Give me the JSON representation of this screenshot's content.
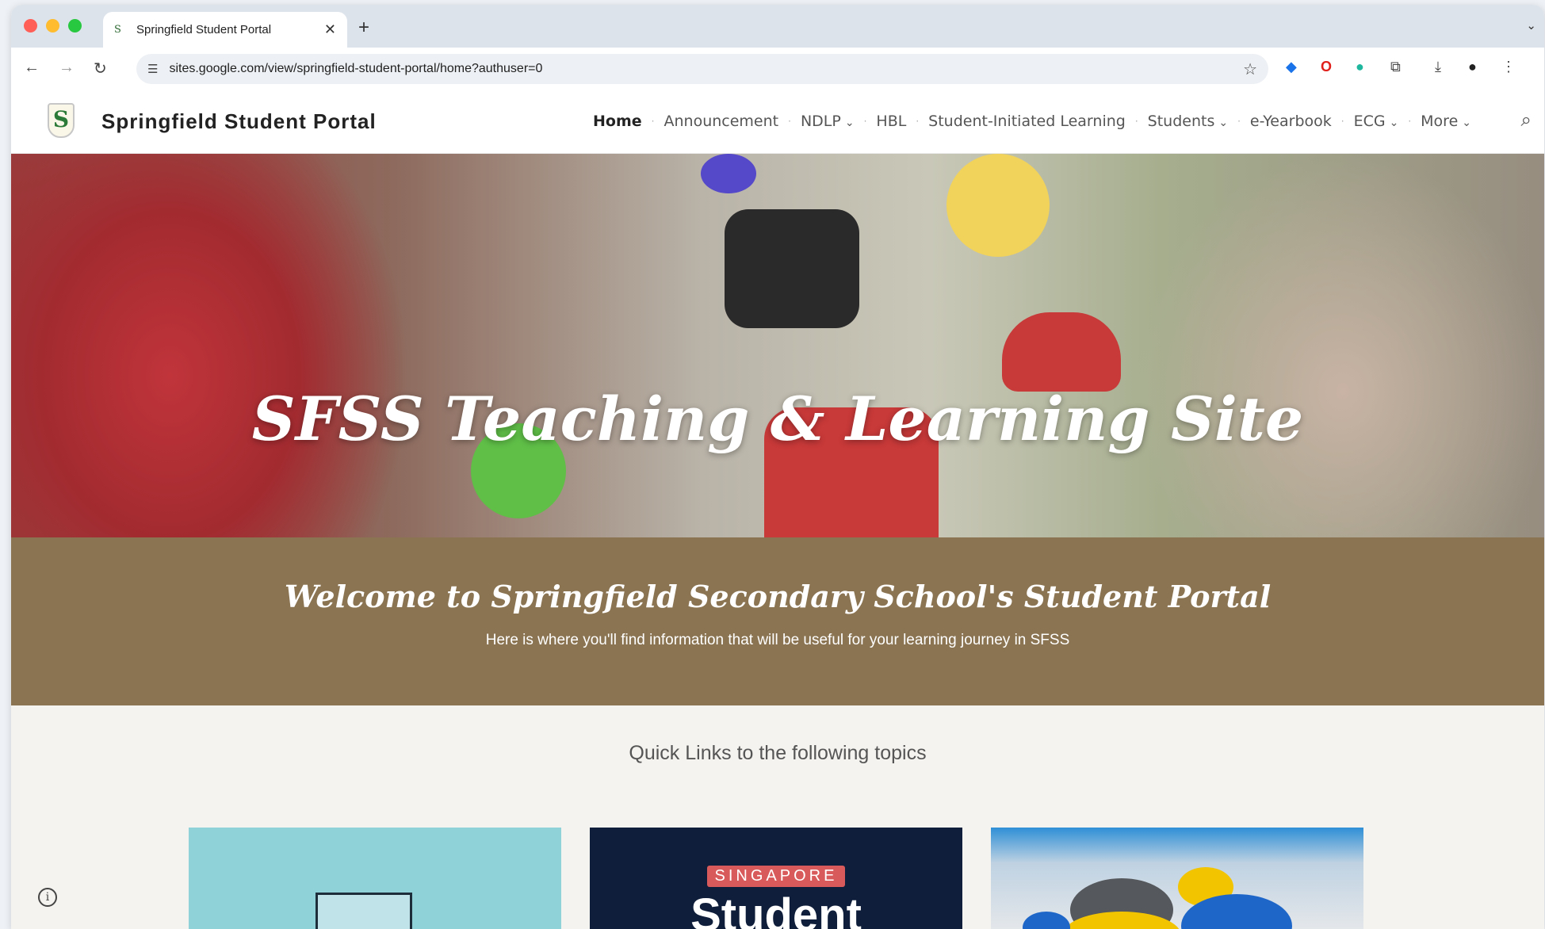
{
  "browser": {
    "tab_title": "Springfield Student Portal",
    "tab_close": "✕",
    "new_tab": "+",
    "url": "sites.google.com/view/springfield-student-portal/home?authuser=0"
  },
  "site": {
    "logo_letter": "S",
    "title": "Springfield Student Portal",
    "nav": [
      {
        "label": "Home",
        "has_menu": false
      },
      {
        "label": "Announcement",
        "has_menu": false
      },
      {
        "label": "NDLP",
        "has_menu": true
      },
      {
        "label": "HBL",
        "has_menu": false
      },
      {
        "label": "Student-Initiated Learning",
        "has_menu": false
      },
      {
        "label": "Students",
        "has_menu": true
      },
      {
        "label": "e-Yearbook",
        "has_menu": false
      },
      {
        "label": "ECG",
        "has_menu": true
      },
      {
        "label": "More",
        "has_menu": true
      }
    ]
  },
  "hero": {
    "title": "SFSS Teaching & Learning Site"
  },
  "welcome": {
    "title": "Welcome to Springfield Secondary School's Student Portal",
    "subtitle": "Here is where you'll find information that will be useful for your learning journey in SFSS"
  },
  "quick_links": {
    "heading": "Quick Links to the following topics",
    "card2_tag": "SINGAPORE",
    "card2_text": "Student"
  },
  "colors": {
    "welcome_band": "#8a7452",
    "card_teal": "#8fd3d8",
    "card_navy": "#0f1e3a"
  },
  "icons": [
    "back-icon",
    "forward-icon",
    "reload-icon",
    "tune-icon",
    "star-icon",
    "download-icon",
    "search-icon",
    "chevron-down-icon",
    "info-icon"
  ]
}
